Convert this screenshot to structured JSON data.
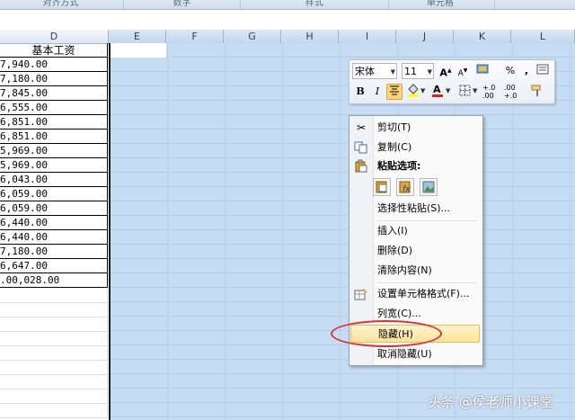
{
  "ribbon_groups": [
    "对齐方式",
    "数字",
    "样式",
    "单元格"
  ],
  "columns": [
    {
      "id": "D",
      "selected": false
    },
    {
      "id": "E",
      "selected": true
    },
    {
      "id": "F",
      "selected": true
    },
    {
      "id": "G",
      "selected": true
    },
    {
      "id": "H",
      "selected": true
    },
    {
      "id": "I",
      "selected": true
    },
    {
      "id": "J",
      "selected": true
    },
    {
      "id": "K",
      "selected": true
    },
    {
      "id": "L",
      "selected": true
    }
  ],
  "column_d": {
    "header": "基本工资",
    "values": [
      "7,940.00",
      "7,180.00",
      "7,845.00",
      "6,555.00",
      "6,851.00",
      "6,851.00",
      "5,969.00",
      "5,969.00",
      "6,043.00",
      "6,059.00",
      "6,059.00",
      "6,440.00",
      "6,440.00",
      "7,180.00",
      "6,647.00",
      ".00,028.00"
    ]
  },
  "mini_toolbar": {
    "font_name": "宋体",
    "font_size": "11",
    "bold_label": "B",
    "italic_label": "I",
    "percent_label": "%",
    "comma_label": ",",
    "inc_decimal_label": "+.0 .00",
    "dec_decimal_label": ".00 +.0"
  },
  "context_menu": {
    "cut": "剪切(T)",
    "copy": "复制(C)",
    "paste_options": "粘贴选项:",
    "paste_special": "选择性粘贴(S)...",
    "insert": "插入(I)",
    "delete": "删除(D)",
    "clear_contents": "清除内容(N)",
    "format_cells": "设置单元格格式(F)...",
    "column_width": "列宽(C)...",
    "hide": "隐藏(H)",
    "unhide": "取消隐藏(U)"
  },
  "watermark": "头条 @侯老师小课堂",
  "colors": {
    "selection": "#c6dcf3",
    "highlight": "#fde39a",
    "annotation_oval": "#d8333a"
  }
}
